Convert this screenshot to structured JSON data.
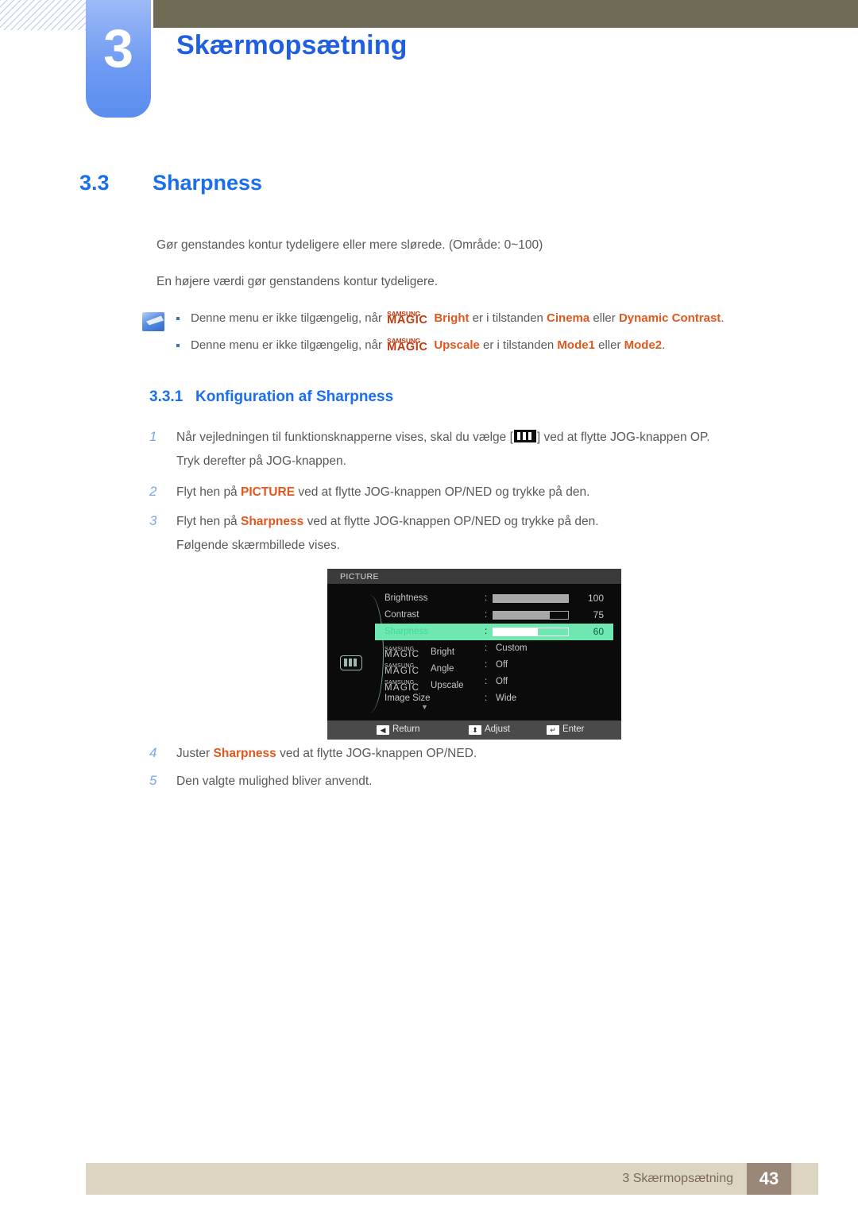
{
  "header": {
    "chapter_number": "3",
    "chapter_title": "Skærmopsætning"
  },
  "section": {
    "number": "3.3",
    "title": "Sharpness",
    "intro_1": "Gør genstandes kontur tydeligere eller mere slørede. (Område: 0~100)",
    "intro_2": "En højere værdi gør genstandens kontur tydeligere."
  },
  "note": {
    "icon": "note-pencil-icon",
    "lines": [
      {
        "prefix": "Denne menu er ikke tilgængelig, når",
        "magic_top": "SAMSUNG",
        "magic_bottom": "MAGIC",
        "feature": "Bright",
        "middle": "er i tilstanden",
        "option_1": "Cinema",
        "conjunction": "eller",
        "option_2": "Dynamic Contrast",
        "suffix": "."
      },
      {
        "prefix": "Denne menu er ikke tilgængelig, når",
        "magic_top": "SAMSUNG",
        "magic_bottom": "MAGIC",
        "feature": "Upscale",
        "middle": "er i tilstanden",
        "option_1": "Mode1",
        "conjunction": "eller",
        "option_2": "Mode2",
        "suffix": "."
      }
    ]
  },
  "subsection": {
    "number": "3.3.1",
    "title": "Konfiguration af Sharpness"
  },
  "steps": {
    "s1_num": "1",
    "s1_a": "Når vejledningen til funktionsknapperne vises, skal du vælge [",
    "s1_b": "] ved at flytte JOG-knappen OP.",
    "s1_cont": "Tryk derefter på JOG-knappen.",
    "s2_num": "2",
    "s2_a": "Flyt hen på",
    "s2_highlight": "PICTURE",
    "s2_b": "ved at flytte JOG-knappen OP/NED og trykke på den.",
    "s3_num": "3",
    "s3_a": "Flyt hen på",
    "s3_highlight": "Sharpness",
    "s3_b": "ved at flytte JOG-knappen OP/NED og trykke på den.",
    "s3_cont": "Følgende skærmbillede vises.",
    "s4_num": "4",
    "s4_a": "Juster",
    "s4_highlight": "Sharpness",
    "s4_b": "ved at flytte JOG-knappen OP/NED.",
    "s5_num": "5",
    "s5_a": "Den valgte mulighed bliver anvendt."
  },
  "osd": {
    "title": "PICTURE",
    "side_icon": "picture-menu-icon",
    "rows": [
      {
        "label": "Brightness",
        "colon": ":",
        "value": "100",
        "type": "slider",
        "fill_percent": 100
      },
      {
        "label": "Contrast",
        "colon": ":",
        "value": "75",
        "type": "slider",
        "fill_percent": 75
      },
      {
        "label": "Sharpness",
        "colon": ":",
        "value": "60",
        "type": "slider",
        "fill_percent": 60,
        "selected": true
      },
      {
        "magic_top": "SAMSUNG",
        "magic_bottom": "MAGIC",
        "label": "Bright",
        "colon": ":",
        "value": "Custom",
        "type": "option"
      },
      {
        "magic_top": "SAMSUNG",
        "magic_bottom": "MAGIC",
        "label": "Angle",
        "colon": ":",
        "value": "Off",
        "type": "option"
      },
      {
        "magic_top": "SAMSUNG",
        "magic_bottom": "MAGIC",
        "label": "Upscale",
        "colon": ":",
        "value": "Off",
        "type": "option"
      },
      {
        "label": "Image Size",
        "colon": ":",
        "value": "Wide",
        "type": "option"
      }
    ],
    "scroll_caret": "▼",
    "footer": [
      {
        "key": "◀",
        "label": "Return"
      },
      {
        "key": "⬍",
        "label": "Adjust"
      },
      {
        "key": "↵",
        "label": "Enter"
      }
    ]
  },
  "page_footer": {
    "text": "3 Skærmopsætning",
    "page_number": "43"
  },
  "colors": {
    "accent_blue": "#1a6ef0",
    "highlight_orange": "#e2571e",
    "magic_red": "#c03a10",
    "osd_green": "#6ee8b0",
    "footer_beige": "#dcd5c2",
    "footer_brown": "#998878",
    "header_olive": "#6e6a55"
  }
}
